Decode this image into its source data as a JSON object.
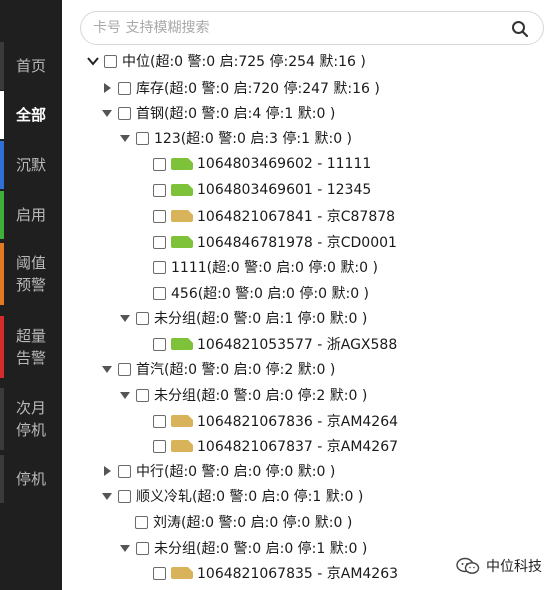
{
  "sidebar": {
    "items": [
      {
        "label": "首页",
        "accent": "#3a3a3a"
      },
      {
        "label": "全部",
        "accent": "#ffffff",
        "active": true
      },
      {
        "label": "沉默",
        "accent": "#2f6fd6"
      },
      {
        "label": "启用",
        "accent": "#3fae3a"
      },
      {
        "label": "阈值\n预警",
        "accent": "#e07b24"
      },
      {
        "label": "超量\n告警",
        "accent": "#d52b2b"
      },
      {
        "label": "次月\n停机",
        "accent": "#3a3a3a"
      },
      {
        "label": "停机",
        "accent": "#3a3a3a"
      }
    ]
  },
  "search": {
    "placeholder": "卡号 支持模糊搜索"
  },
  "tree": [
    {
      "label": "中位(超:0 警:0 启:725 停:254 默:16 )",
      "caret": "down"
    },
    {
      "label": "库存(超:0 警:0 启:720 停:247 默:16 )",
      "caret": "right"
    },
    {
      "label": "首钢(超:0 警:0 启:4 停:1 默:0 )",
      "caret": "down"
    },
    {
      "label": "123(超:0 警:0 启:3 停:1 默:0 )",
      "caret": "down"
    },
    {
      "label": "1064803469602 - 11111",
      "sim": "green"
    },
    {
      "label": "1064803469601 - 12345",
      "sim": "green"
    },
    {
      "label": "1064821067841 - 京C87878",
      "sim": "yellow"
    },
    {
      "label": "1064846781978 - 京CD0001",
      "sim": "green"
    },
    {
      "label": "1111(超:0 警:0 启:0 停:0 默:0 )"
    },
    {
      "label": "456(超:0 警:0 启:0 停:0 默:0 )"
    },
    {
      "label": "未分组(超:0 警:0 启:1 停:0 默:0 )",
      "caret": "down"
    },
    {
      "label": "1064821053577 - 浙AGX588",
      "sim": "green"
    },
    {
      "label": "首汽(超:0 警:0 启:0 停:2 默:0 )",
      "caret": "down"
    },
    {
      "label": "未分组(超:0 警:0 启:0 停:2 默:0 )",
      "caret": "down"
    },
    {
      "label": "1064821067836 - 京AM4264",
      "sim": "yellow"
    },
    {
      "label": "1064821067837 - 京AM4267",
      "sim": "yellow"
    },
    {
      "label": "中行(超:0 警:0 启:0 停:0 默:0 )",
      "caret": "right"
    },
    {
      "label": "顺义冷轧(超:0 警:0 启:0 停:1 默:0 )",
      "caret": "down"
    },
    {
      "label": "刘涛(超:0 警:0 启:0 停:0 默:0 )"
    },
    {
      "label": "未分组(超:0 警:0 启:0 停:1 默:0 )",
      "caret": "down"
    },
    {
      "label": "1064821067835 - 京AM4263",
      "sim": "yellow"
    }
  ],
  "colors": {
    "sim_green": "#7ec23a",
    "sim_yellow": "#d8b35a"
  },
  "watermark": {
    "text": "中位科技",
    "icon": "wechat-icon"
  }
}
